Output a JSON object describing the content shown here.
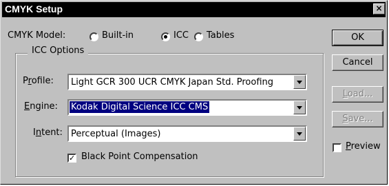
{
  "window": {
    "title": "CMYK Setup",
    "close_glyph": "×"
  },
  "cmyk_model": {
    "label": "CMYK Model:",
    "options": [
      "Built-in",
      "ICC",
      "Tables"
    ],
    "selected": "ICC"
  },
  "icc_options": {
    "legend": "ICC Options",
    "profile": {
      "label_pre": "P",
      "label_ul": "r",
      "label_post": "ofile:",
      "value": "Light GCR 300 UCR CMYK Japan Std. Proofing"
    },
    "engine": {
      "label_pre": "",
      "label_ul": "E",
      "label_post": "ngine:",
      "value": "Kodak Digital Science ICC CMS"
    },
    "intent": {
      "label_pre": "I",
      "label_ul": "n",
      "label_post": "tent:",
      "value": "Perceptual (Images)"
    },
    "black_point": {
      "label": "Black Point Compensation",
      "checked": true
    }
  },
  "buttons": {
    "ok": "OK",
    "cancel": "Cancel",
    "load_ul": "L",
    "load_post": "oad...",
    "save_ul": "S",
    "save_post": "ave..."
  },
  "preview": {
    "label_ul": "P",
    "label_post": "review",
    "checked": false
  }
}
